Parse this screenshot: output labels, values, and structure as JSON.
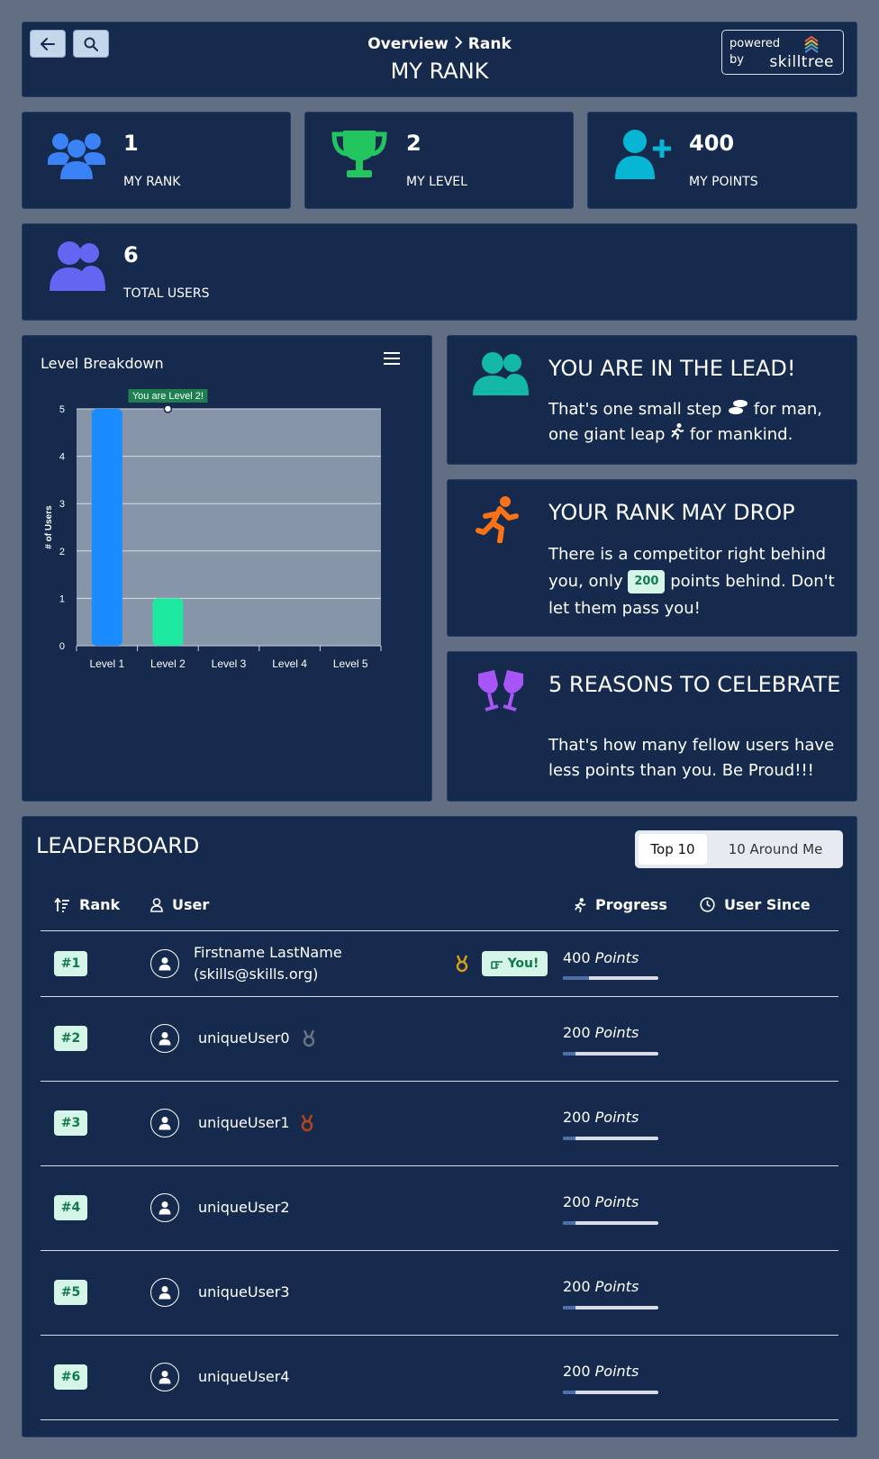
{
  "header": {
    "back_icon": "arrow-left-icon",
    "search_icon": "search-icon",
    "breadcrumb": [
      "Overview",
      "Rank"
    ],
    "title": "MY RANK",
    "powered_line1": "powered",
    "powered_line2": "by",
    "brand": "skilltree"
  },
  "stats": [
    {
      "value": "1",
      "label": "MY RANK",
      "icon": "users-icon",
      "color": "#3b82f6"
    },
    {
      "value": "2",
      "label": "MY LEVEL",
      "icon": "trophy-icon",
      "color": "#22c55e"
    },
    {
      "value": "400",
      "label": "MY POINTS",
      "icon": "user-plus-icon",
      "color": "#06b6d4"
    },
    {
      "value": "6",
      "label": "TOTAL USERS",
      "icon": "user-friends-icon",
      "color": "#6366f1"
    }
  ],
  "chart_card": {
    "title": "Level Breakdown"
  },
  "chart_data": {
    "type": "bar",
    "title": "Level Breakdown",
    "categories": [
      "Level 1",
      "Level 2",
      "Level 3",
      "Level 4",
      "Level 5"
    ],
    "values": [
      5,
      1,
      0,
      0,
      0
    ],
    "colors": [
      "#1a8cff",
      "#1de9a0"
    ],
    "ylabel": "# of Users",
    "xlabel": "",
    "ylim": [
      0,
      5
    ],
    "yticks": [
      0,
      1,
      2,
      3,
      4,
      5
    ],
    "grid": true,
    "annotation": {
      "text": "You are Level 2!",
      "category": "Level 2"
    }
  },
  "info": {
    "lead": {
      "title": "YOU ARE IN THE LEAD!",
      "text_a": "That's one small step",
      "text_b": "for man, one giant leap",
      "text_c": "for mankind."
    },
    "drop": {
      "title": "YOUR RANK MAY DROP",
      "text_a": "There is a competitor right behind you, only",
      "points": "200",
      "text_b": "points behind. Don't let them pass you!"
    },
    "celebrate": {
      "title": "5 REASONS TO CELEBRATE",
      "text": "That's how many fellow users have less points than you. Be Proud!!!"
    }
  },
  "leaderboard": {
    "title": "LEADERBOARD",
    "tab_top": "Top 10",
    "tab_around": "10 Around Me",
    "col_rank": "Rank",
    "col_user": "User",
    "col_progress": "Progress",
    "col_since": "User Since",
    "points_word": "Points",
    "you_label": "You!",
    "rows": [
      {
        "rank": "#1",
        "name": "Firstname LastName",
        "sub": "(skills@skills.org)",
        "points": "400",
        "medal": "gold",
        "progress": 0.27,
        "you": true
      },
      {
        "rank": "#2",
        "name": "uniqueUser0",
        "points": "200",
        "medal": "silver",
        "progress": 0.13
      },
      {
        "rank": "#3",
        "name": "uniqueUser1",
        "points": "200",
        "medal": "bronze",
        "progress": 0.13
      },
      {
        "rank": "#4",
        "name": "uniqueUser2",
        "points": "200",
        "medal": "",
        "progress": 0.13
      },
      {
        "rank": "#5",
        "name": "uniqueUser3",
        "points": "200",
        "medal": "",
        "progress": 0.13
      },
      {
        "rank": "#6",
        "name": "uniqueUser4",
        "points": "200",
        "medal": "",
        "progress": 0.13
      }
    ]
  }
}
